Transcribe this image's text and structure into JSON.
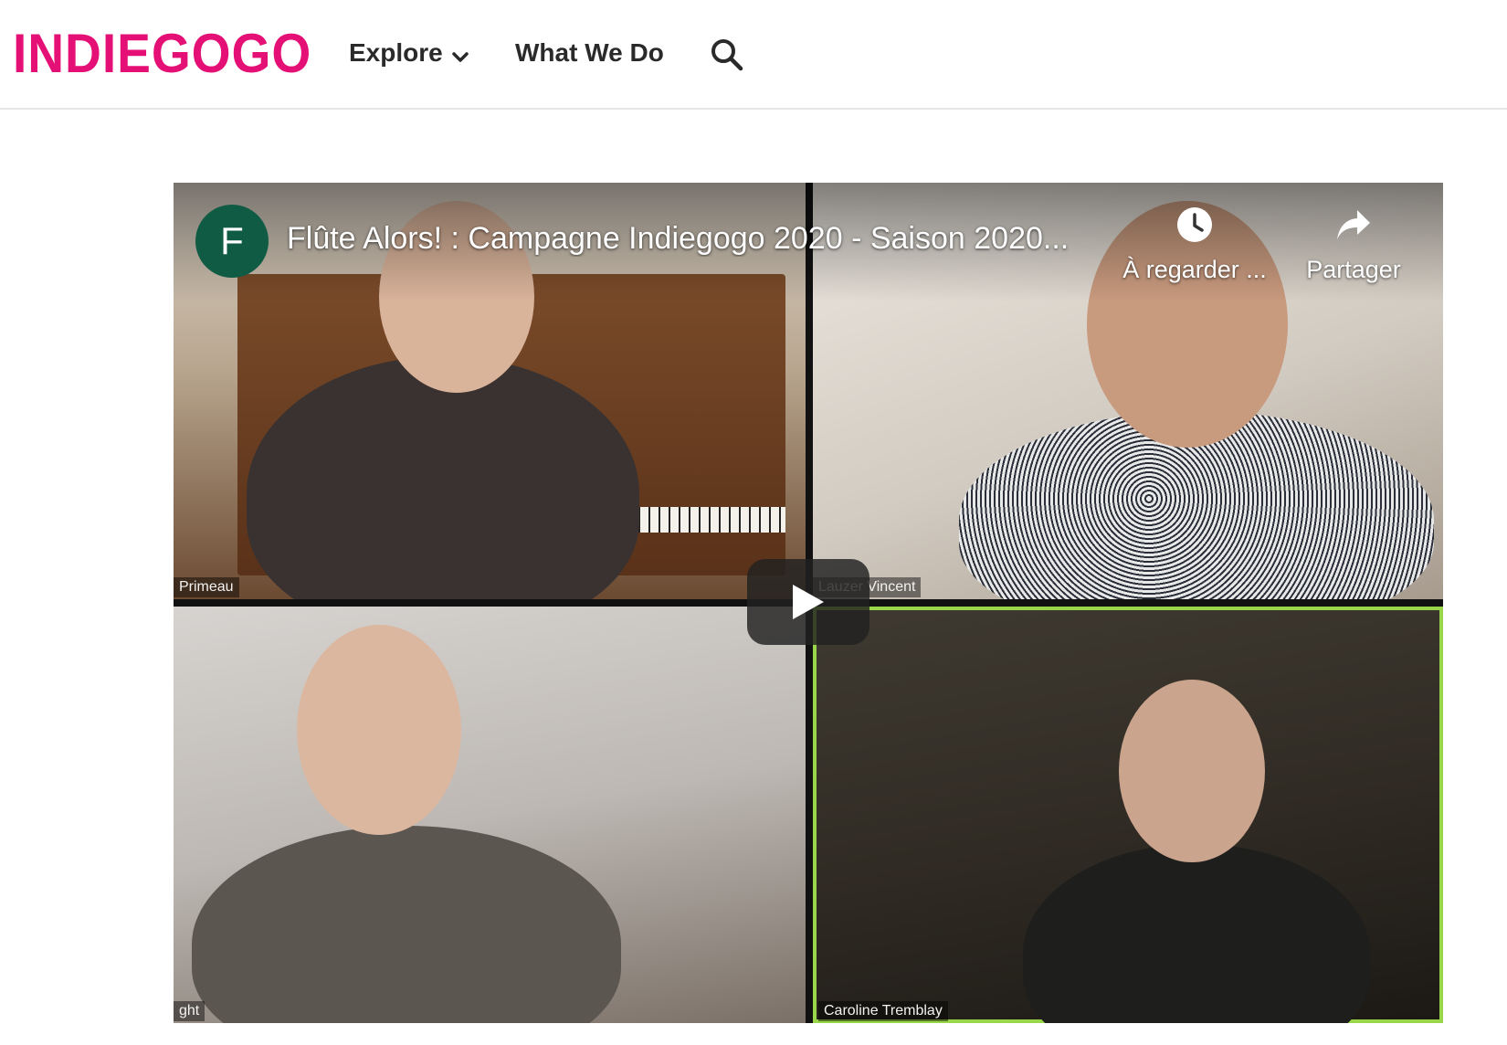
{
  "header": {
    "logo_text": "INDIEGOGO",
    "nav": {
      "explore_label": "Explore",
      "what_we_do_label": "What We Do"
    },
    "search_icon": "search-icon"
  },
  "video": {
    "channel_initial": "F",
    "title": "Flûte Alors! : Campagne Indiegogo 2020 - Saison 2020...",
    "watch_later_label": "À regarder ...",
    "share_label": "Partager",
    "play_icon": "play-icon",
    "participants": {
      "top_left": "Primeau",
      "top_right": "Lauzer Vincent",
      "bottom_left": "ght",
      "bottom_right": "Caroline Tremblay"
    }
  },
  "colors": {
    "brand": "#e51075",
    "channel_avatar": "#0f5b44",
    "active_speaker_border": "#9ad64a"
  }
}
